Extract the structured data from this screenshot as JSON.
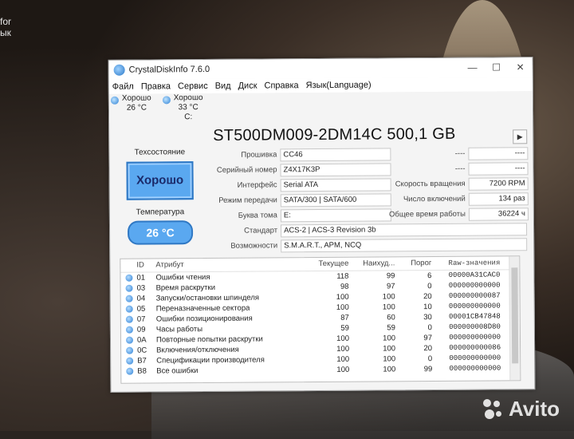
{
  "desktop": {
    "line1": "for",
    "line2": "ык"
  },
  "watermark": "Avito",
  "window": {
    "title": "CrystalDiskInfo 7.6.0",
    "minimize": "—",
    "maximize": "☐",
    "close": "✕"
  },
  "menu": [
    "Файл",
    "Правка",
    "Сервис",
    "Вид",
    "Диск",
    "Справка",
    "Язык(Language)"
  ],
  "drives": [
    {
      "status": "Хорошо",
      "temp": "26 °C",
      "letter": ""
    },
    {
      "status": "Хорошо",
      "temp": "33 °C",
      "letter": "C:"
    }
  ],
  "disk": {
    "model": "ST500DM009-2DM14C 500,1 GB",
    "health_label": "Техсостояние",
    "health": "Хорошо",
    "temp_label": "Температура",
    "temp": "26 °C",
    "fields": [
      {
        "label": "Прошивка",
        "value": "CC46"
      },
      {
        "label": "Серийный номер",
        "value": "Z4X17K3P"
      },
      {
        "label": "Интерфейс",
        "value": "Serial ATA"
      },
      {
        "label": "Режим передачи",
        "value": "SATA/300 | SATA/600"
      },
      {
        "label": "Буква тома",
        "value": "E:"
      },
      {
        "label": "Стандарт",
        "value": "ACS-2 | ACS-3 Revision 3b"
      },
      {
        "label": "Возможности",
        "value": "S.M.A.R.T., APM, NCQ"
      }
    ],
    "right_fields": [
      {
        "label": "----",
        "value": "----"
      },
      {
        "label": "----",
        "value": "----"
      },
      {
        "label": "Скорость вращения",
        "value": "7200 RPM"
      },
      {
        "label": "Число включений",
        "value": "134 раз"
      },
      {
        "label": "Общее время работы",
        "value": "36224 ч"
      }
    ]
  },
  "smart": {
    "headers": [
      "ID",
      "Атрибут",
      "Текущее",
      "Наихуд...",
      "Порог",
      "Raw-значения"
    ],
    "rows": [
      {
        "id": "01",
        "name": "Ошибки чтения",
        "cur": "118",
        "worst": "99",
        "thr": "6",
        "raw": "00000A31CAC0"
      },
      {
        "id": "03",
        "name": "Время раскрутки",
        "cur": "98",
        "worst": "97",
        "thr": "0",
        "raw": "000000000000"
      },
      {
        "id": "04",
        "name": "Запуски/остановки шпинделя",
        "cur": "100",
        "worst": "100",
        "thr": "20",
        "raw": "000000000087"
      },
      {
        "id": "05",
        "name": "Переназначенные сектора",
        "cur": "100",
        "worst": "100",
        "thr": "10",
        "raw": "000000000000"
      },
      {
        "id": "07",
        "name": "Ошибки позиционирования",
        "cur": "87",
        "worst": "60",
        "thr": "30",
        "raw": "00001CB47848"
      },
      {
        "id": "09",
        "name": "Часы работы",
        "cur": "59",
        "worst": "59",
        "thr": "0",
        "raw": "000000008D80"
      },
      {
        "id": "0A",
        "name": "Повторные попытки раскрутки",
        "cur": "100",
        "worst": "100",
        "thr": "97",
        "raw": "000000000000"
      },
      {
        "id": "0C",
        "name": "Включения/отключения",
        "cur": "100",
        "worst": "100",
        "thr": "20",
        "raw": "000000000086"
      },
      {
        "id": "B7",
        "name": "Спецификации производителя",
        "cur": "100",
        "worst": "100",
        "thr": "0",
        "raw": "000000000000"
      },
      {
        "id": "B8",
        "name": "Все ошибки",
        "cur": "100",
        "worst": "100",
        "thr": "99",
        "raw": "000000000000"
      }
    ]
  },
  "colors": {
    "good": "#5aa8f0",
    "good_border": "#2f78c4"
  }
}
